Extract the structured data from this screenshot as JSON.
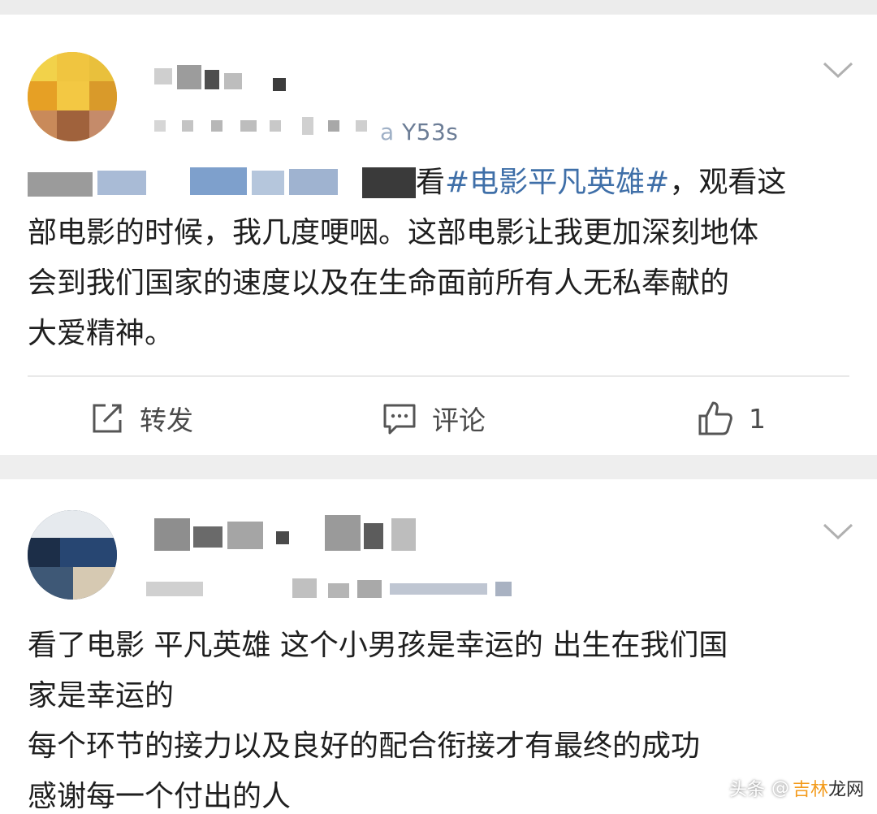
{
  "colors": {
    "hashtag": "#3f6fa8",
    "page_bg": "#eeeeee",
    "card_bg": "#ffffff",
    "icon": "#555555"
  },
  "post1": {
    "handle_suffix": "Y53s",
    "text_segments": {
      "line1_pre": "看",
      "hashtag": "#电影平凡英雄#",
      "line1_post": "，观看这",
      "line2": "部电影的时候，我几度哽咽。这部电影让我更加深刻地体",
      "line3": "会到我们国家的速度以及在生命面前所有人无私奉献的",
      "line4": "大爱精神。"
    },
    "actions": {
      "repost_label": "转发",
      "comment_label": "评论",
      "like_count": "1"
    },
    "icons": {
      "menu": "chevron-down-icon",
      "repost": "share-icon",
      "comment": "comment-icon",
      "like": "thumbs-up-icon"
    }
  },
  "post2": {
    "text_lines": [
      "看了电影 平凡英雄 这个小男孩是幸运的 出生在我们国",
      "家是幸运的",
      "每个环节的接力以及良好的配合衔接才有最终的成功",
      "感谢每一个付出的人"
    ],
    "icons": {
      "menu": "chevron-down-icon"
    }
  },
  "watermark": {
    "prefix": "头条",
    "at": "@",
    "site": "吉林",
    "site2": "龙网"
  }
}
